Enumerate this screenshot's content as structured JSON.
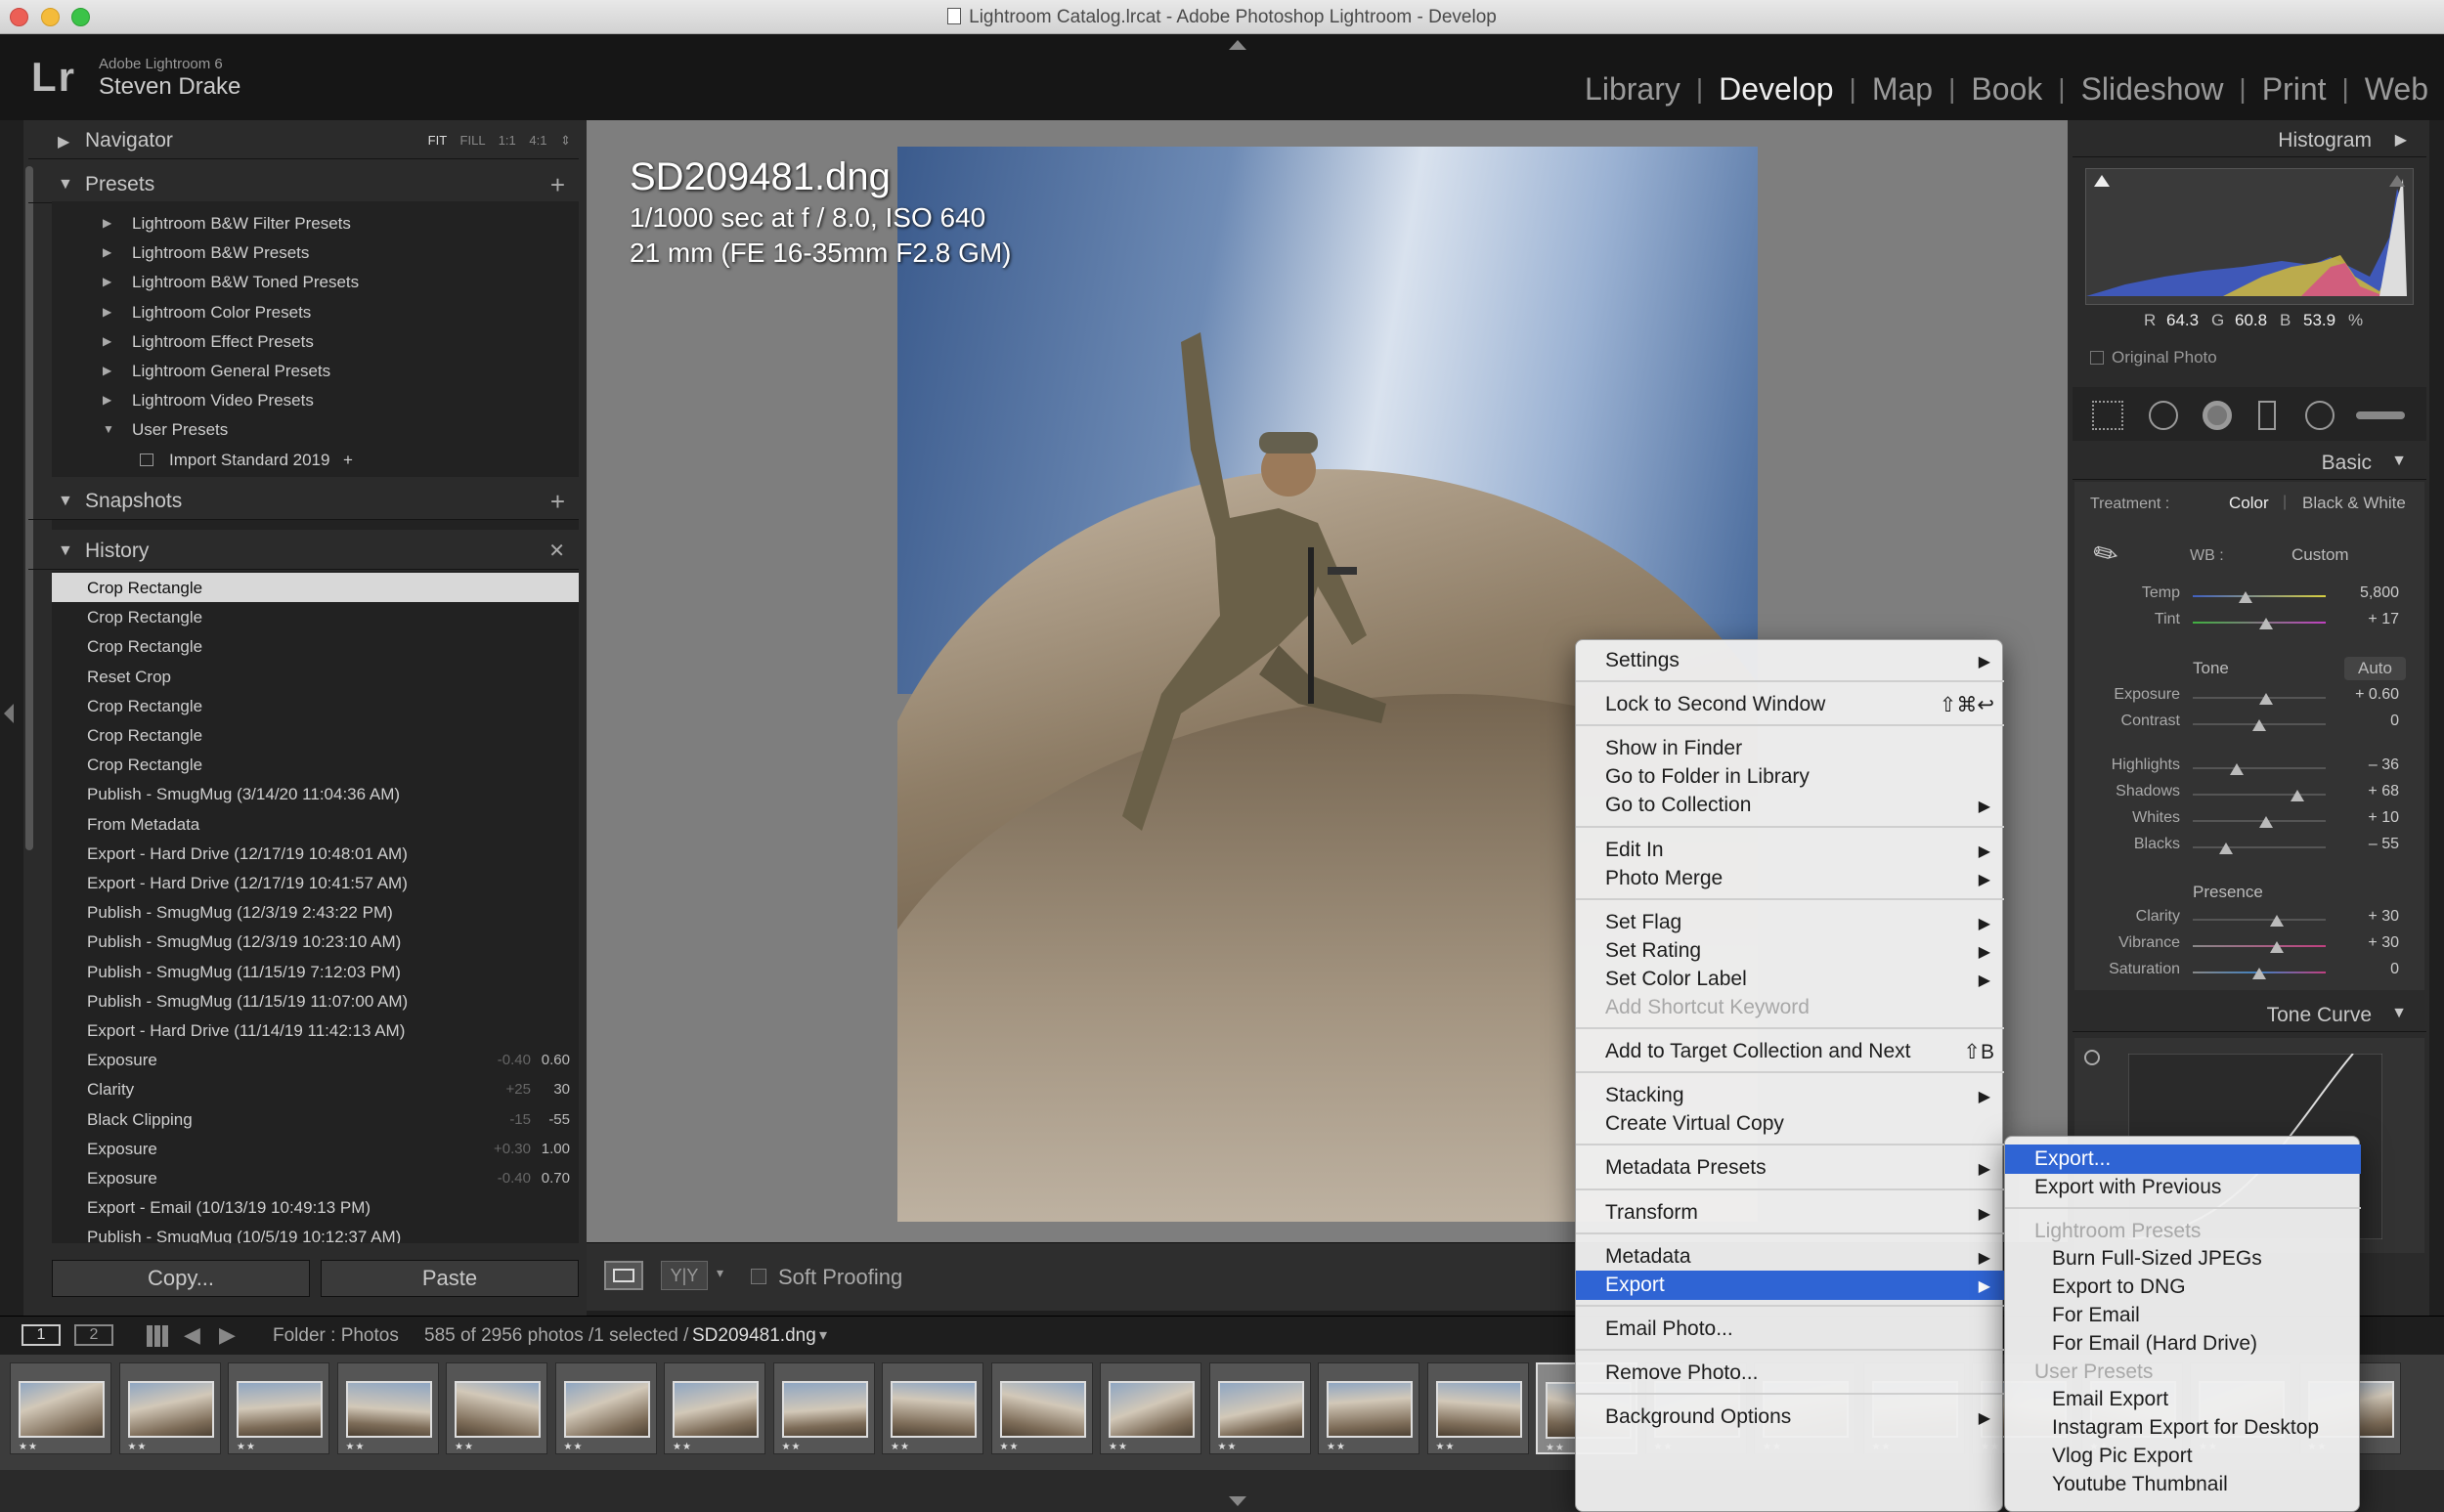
{
  "window": {
    "title": "Lightroom Catalog.lrcat - Adobe Photoshop Lightroom - Develop"
  },
  "identity": {
    "app": "Adobe Lightroom 6",
    "user": "Steven Drake",
    "logo": "Lr"
  },
  "modules": [
    "Library",
    "Develop",
    "Map",
    "Book",
    "Slideshow",
    "Print",
    "Web"
  ],
  "active_module": "Develop",
  "navigator": {
    "title": "Navigator",
    "zoom_options": [
      "FIT",
      "FILL",
      "1:1",
      "4:1"
    ],
    "active_zoom": "FIT"
  },
  "presets": {
    "title": "Presets",
    "items": [
      "Lightroom B&W Filter Presets",
      "Lightroom B&W Presets",
      "Lightroom B&W Toned Presets",
      "Lightroom Color Presets",
      "Lightroom Effect Presets",
      "Lightroom General Presets",
      "Lightroom Video Presets",
      "User Presets"
    ],
    "user_item": "Import Standard 2019",
    "user_item_suffix": "+"
  },
  "snapshots": {
    "title": "Snapshots"
  },
  "history": {
    "title": "History",
    "items": [
      {
        "label": "Crop Rectangle"
      },
      {
        "label": "Crop Rectangle"
      },
      {
        "label": "Crop Rectangle"
      },
      {
        "label": "Reset Crop"
      },
      {
        "label": "Crop Rectangle"
      },
      {
        "label": "Crop Rectangle"
      },
      {
        "label": "Crop Rectangle"
      },
      {
        "label": "Publish - SmugMug (3/14/20 11:04:36 AM)"
      },
      {
        "label": "From Metadata"
      },
      {
        "label": "Export - Hard Drive (12/17/19 10:48:01 AM)"
      },
      {
        "label": "Export - Hard Drive (12/17/19 10:41:57 AM)"
      },
      {
        "label": "Publish - SmugMug (12/3/19 2:43:22 PM)"
      },
      {
        "label": "Publish - SmugMug (12/3/19 10:23:10 AM)"
      },
      {
        "label": "Publish - SmugMug (11/15/19 7:12:03 PM)"
      },
      {
        "label": "Publish - SmugMug (11/15/19 11:07:00 AM)"
      },
      {
        "label": "Export - Hard Drive (11/14/19 11:42:13 AM)"
      },
      {
        "label": "Exposure",
        "delta": "-0.40",
        "value": "0.60"
      },
      {
        "label": "Clarity",
        "delta": "+25",
        "value": "30"
      },
      {
        "label": "Black Clipping",
        "delta": "-15",
        "value": "-55"
      },
      {
        "label": "Exposure",
        "delta": "+0.30",
        "value": "1.00"
      },
      {
        "label": "Exposure",
        "delta": "-0.40",
        "value": "0.70"
      },
      {
        "label": "Export - Email (10/13/19 10:49:13 PM)"
      },
      {
        "label": "Publish - SmugMug (10/5/19 10:12:37 AM)"
      }
    ]
  },
  "buttons": {
    "copy": "Copy...",
    "paste": "Paste"
  },
  "photo_info": {
    "filename": "SD209481.dng",
    "exposure": "1/1000 sec at f / 8.0, ISO 640",
    "lens": "21 mm (FE 16-35mm F2.8 GM)"
  },
  "toolbar": {
    "soft_proofing": "Soft Proofing",
    "compare_label": "Y|Y"
  },
  "histogram": {
    "title": "Histogram",
    "r_label": "R",
    "r": "64.3",
    "g_label": "G",
    "g": "60.8",
    "b_label": "B",
    "b": "53.9",
    "pct": "%",
    "original_photo": "Original Photo"
  },
  "basic": {
    "title": "Basic",
    "treatment_label": "Treatment :",
    "treatment_color": "Color",
    "treatment_bw": "Black & White",
    "wb_label": "WB :",
    "wb_value": "Custom",
    "tone_label": "Tone",
    "auto_label": "Auto",
    "presence_label": "Presence",
    "sliders": [
      {
        "label": "Temp",
        "value": "5,800",
        "pos": 0.4
      },
      {
        "label": "Tint",
        "value": "+ 17",
        "pos": 0.55
      },
      {
        "label": "Exposure",
        "value": "+ 0.60",
        "pos": 0.55
      },
      {
        "label": "Contrast",
        "value": "0",
        "pos": 0.5
      },
      {
        "label": "Highlights",
        "value": "– 36",
        "pos": 0.33
      },
      {
        "label": "Shadows",
        "value": "+ 68",
        "pos": 0.79
      },
      {
        "label": "Whites",
        "value": "+ 10",
        "pos": 0.55
      },
      {
        "label": "Blacks",
        "value": "– 55",
        "pos": 0.25
      },
      {
        "label": "Clarity",
        "value": "+ 30",
        "pos": 0.63
      },
      {
        "label": "Vibrance",
        "value": "+ 30",
        "pos": 0.63
      },
      {
        "label": "Saturation",
        "value": "0",
        "pos": 0.5
      }
    ]
  },
  "tone_curve": {
    "title": "Tone Curve"
  },
  "statusbar": {
    "page1": "1",
    "page2": "2",
    "folder": "Folder : Photos",
    "count": "585 of 2956 photos /1 selected /",
    "file": "SD209481.dng"
  },
  "context_menu": {
    "items": [
      {
        "label": "Settings",
        "sub": true
      },
      {
        "sep": true
      },
      {
        "label": "Lock to Second Window",
        "shortcut": "⇧⌘↩"
      },
      {
        "sep": true
      },
      {
        "label": "Show in Finder"
      },
      {
        "label": "Go to Folder in Library"
      },
      {
        "label": "Go to Collection",
        "sub": true
      },
      {
        "sep": true
      },
      {
        "label": "Edit In",
        "sub": true
      },
      {
        "label": "Photo Merge",
        "sub": true
      },
      {
        "sep": true
      },
      {
        "label": "Set Flag",
        "sub": true
      },
      {
        "label": "Set Rating",
        "sub": true
      },
      {
        "label": "Set Color Label",
        "sub": true
      },
      {
        "label": "Add Shortcut Keyword",
        "disabled": true
      },
      {
        "sep": true
      },
      {
        "label": "Add to Target Collection and Next",
        "shortcut": "⇧B"
      },
      {
        "sep": true
      },
      {
        "label": "Stacking",
        "sub": true
      },
      {
        "label": "Create Virtual Copy"
      },
      {
        "sep": true
      },
      {
        "label": "Metadata Presets",
        "sub": true
      },
      {
        "sep": true
      },
      {
        "label": "Transform",
        "sub": true
      },
      {
        "sep": true
      },
      {
        "label": "Metadata",
        "sub": true
      },
      {
        "label": "Export",
        "sub": true,
        "highlighted": true
      },
      {
        "sep": true
      },
      {
        "label": "Email Photo..."
      },
      {
        "sep": true
      },
      {
        "label": "Remove Photo..."
      },
      {
        "sep": true
      },
      {
        "label": "Background Options",
        "sub": true
      }
    ]
  },
  "export_submenu": {
    "items": [
      {
        "label": "Export...",
        "highlighted": true
      },
      {
        "label": "Export with Previous"
      },
      {
        "sep": true
      },
      {
        "header": "Lightroom Presets"
      },
      {
        "label": "Burn Full-Sized JPEGs"
      },
      {
        "label": "Export to DNG"
      },
      {
        "label": "For Email"
      },
      {
        "label": "For Email (Hard Drive)"
      },
      {
        "header": "User Presets"
      },
      {
        "label": "Email Export"
      },
      {
        "label": "Instagram Export for Desktop"
      },
      {
        "label": "Vlog Pic Export"
      },
      {
        "label": "Youtube Thumbnail"
      }
    ]
  },
  "filmstrip": {
    "stars": "★★"
  },
  "colors": {
    "accent": "#2f64d4",
    "panel": "#2b2b2b",
    "background": "#7e7e7e"
  }
}
